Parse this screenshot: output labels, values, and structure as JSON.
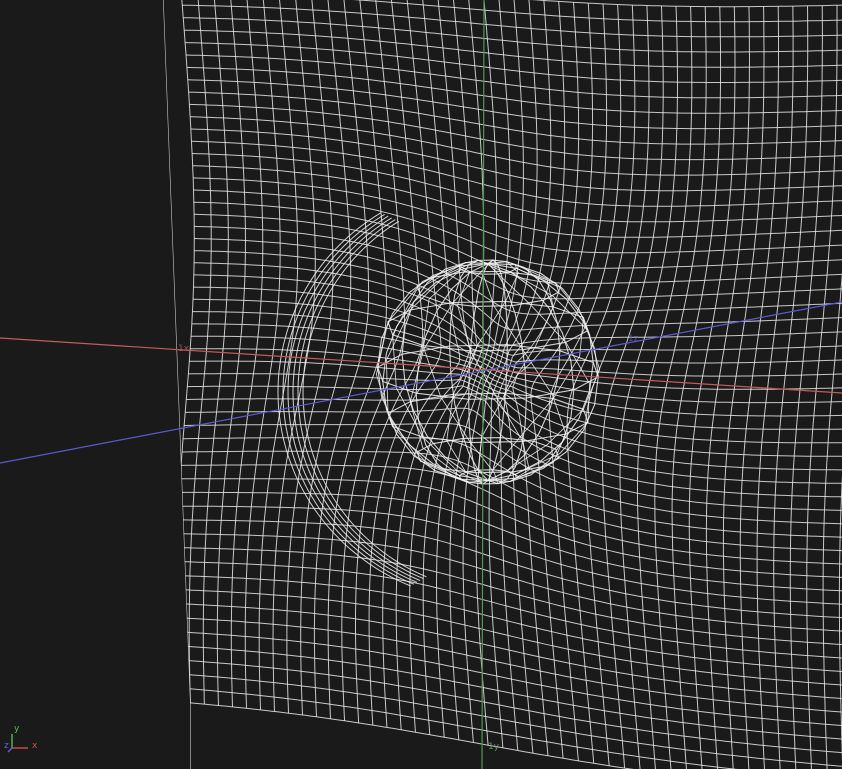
{
  "viewport": {
    "background": "#1a1a1a",
    "grid_color": "#e8e8e8",
    "sphere_color": "#f2f2f2"
  },
  "axes": {
    "x": {
      "color": "#c65a5a",
      "label": "1x"
    },
    "y": {
      "color": "#4f9a4f",
      "label": "1y"
    },
    "z": {
      "color": "#5a5ad0",
      "label": "1z"
    }
  },
  "gizmo": {
    "x_label": "x",
    "y_label": "y",
    "z_label": "z",
    "x_color": "#d05050",
    "y_color": "#50c050",
    "z_color": "#6060e0"
  }
}
